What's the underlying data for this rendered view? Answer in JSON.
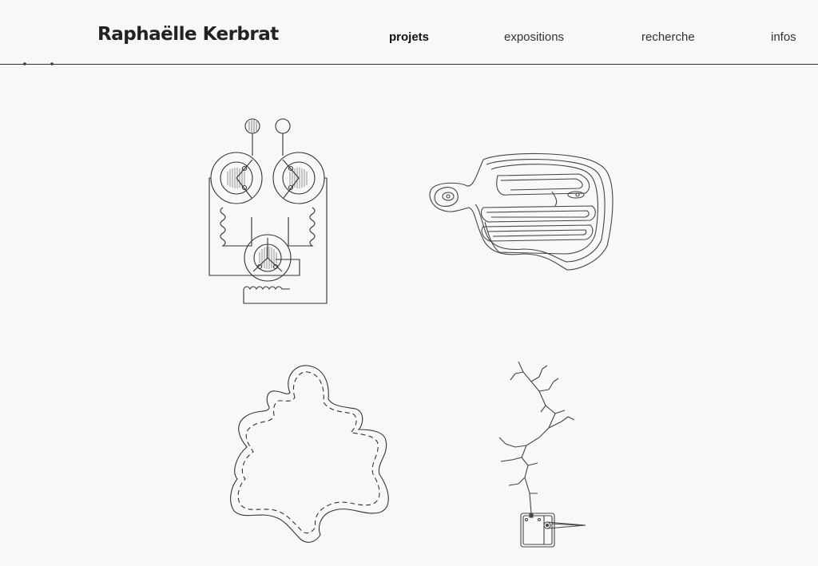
{
  "header": {
    "site_title": "Raphaëlle Kerbrat",
    "nav": [
      {
        "label": "projets",
        "active": true
      },
      {
        "label": "expositions",
        "active": false
      },
      {
        "label": "recherche",
        "active": false
      },
      {
        "label": "infos",
        "active": false
      }
    ]
  },
  "projects": [
    {
      "icon": "circuit-coils-drawing"
    },
    {
      "icon": "maze-blob-drawing"
    },
    {
      "icon": "leaf-outline-drawing"
    },
    {
      "icon": "branch-circuit-drawing"
    }
  ],
  "colors": {
    "background": "#f7f8fa",
    "ink": "#333333"
  }
}
